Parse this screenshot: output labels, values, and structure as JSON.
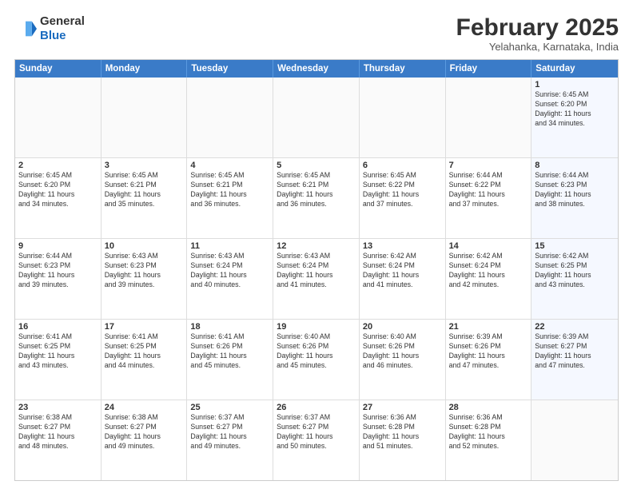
{
  "header": {
    "logo_general": "General",
    "logo_blue": "Blue",
    "month": "February 2025",
    "location": "Yelahanka, Karnataka, India"
  },
  "weekdays": [
    "Sunday",
    "Monday",
    "Tuesday",
    "Wednesday",
    "Thursday",
    "Friday",
    "Saturday"
  ],
  "rows": [
    [
      {
        "day": "",
        "info": ""
      },
      {
        "day": "",
        "info": ""
      },
      {
        "day": "",
        "info": ""
      },
      {
        "day": "",
        "info": ""
      },
      {
        "day": "",
        "info": ""
      },
      {
        "day": "",
        "info": ""
      },
      {
        "day": "1",
        "info": "Sunrise: 6:45 AM\nSunset: 6:20 PM\nDaylight: 11 hours\nand 34 minutes."
      }
    ],
    [
      {
        "day": "2",
        "info": "Sunrise: 6:45 AM\nSunset: 6:20 PM\nDaylight: 11 hours\nand 34 minutes."
      },
      {
        "day": "3",
        "info": "Sunrise: 6:45 AM\nSunset: 6:21 PM\nDaylight: 11 hours\nand 35 minutes."
      },
      {
        "day": "4",
        "info": "Sunrise: 6:45 AM\nSunset: 6:21 PM\nDaylight: 11 hours\nand 36 minutes."
      },
      {
        "day": "5",
        "info": "Sunrise: 6:45 AM\nSunset: 6:21 PM\nDaylight: 11 hours\nand 36 minutes."
      },
      {
        "day": "6",
        "info": "Sunrise: 6:45 AM\nSunset: 6:22 PM\nDaylight: 11 hours\nand 37 minutes."
      },
      {
        "day": "7",
        "info": "Sunrise: 6:44 AM\nSunset: 6:22 PM\nDaylight: 11 hours\nand 37 minutes."
      },
      {
        "day": "8",
        "info": "Sunrise: 6:44 AM\nSunset: 6:23 PM\nDaylight: 11 hours\nand 38 minutes."
      }
    ],
    [
      {
        "day": "9",
        "info": "Sunrise: 6:44 AM\nSunset: 6:23 PM\nDaylight: 11 hours\nand 39 minutes."
      },
      {
        "day": "10",
        "info": "Sunrise: 6:43 AM\nSunset: 6:23 PM\nDaylight: 11 hours\nand 39 minutes."
      },
      {
        "day": "11",
        "info": "Sunrise: 6:43 AM\nSunset: 6:24 PM\nDaylight: 11 hours\nand 40 minutes."
      },
      {
        "day": "12",
        "info": "Sunrise: 6:43 AM\nSunset: 6:24 PM\nDaylight: 11 hours\nand 41 minutes."
      },
      {
        "day": "13",
        "info": "Sunrise: 6:42 AM\nSunset: 6:24 PM\nDaylight: 11 hours\nand 41 minutes."
      },
      {
        "day": "14",
        "info": "Sunrise: 6:42 AM\nSunset: 6:24 PM\nDaylight: 11 hours\nand 42 minutes."
      },
      {
        "day": "15",
        "info": "Sunrise: 6:42 AM\nSunset: 6:25 PM\nDaylight: 11 hours\nand 43 minutes."
      }
    ],
    [
      {
        "day": "16",
        "info": "Sunrise: 6:41 AM\nSunset: 6:25 PM\nDaylight: 11 hours\nand 43 minutes."
      },
      {
        "day": "17",
        "info": "Sunrise: 6:41 AM\nSunset: 6:25 PM\nDaylight: 11 hours\nand 44 minutes."
      },
      {
        "day": "18",
        "info": "Sunrise: 6:41 AM\nSunset: 6:26 PM\nDaylight: 11 hours\nand 45 minutes."
      },
      {
        "day": "19",
        "info": "Sunrise: 6:40 AM\nSunset: 6:26 PM\nDaylight: 11 hours\nand 45 minutes."
      },
      {
        "day": "20",
        "info": "Sunrise: 6:40 AM\nSunset: 6:26 PM\nDaylight: 11 hours\nand 46 minutes."
      },
      {
        "day": "21",
        "info": "Sunrise: 6:39 AM\nSunset: 6:26 PM\nDaylight: 11 hours\nand 47 minutes."
      },
      {
        "day": "22",
        "info": "Sunrise: 6:39 AM\nSunset: 6:27 PM\nDaylight: 11 hours\nand 47 minutes."
      }
    ],
    [
      {
        "day": "23",
        "info": "Sunrise: 6:38 AM\nSunset: 6:27 PM\nDaylight: 11 hours\nand 48 minutes."
      },
      {
        "day": "24",
        "info": "Sunrise: 6:38 AM\nSunset: 6:27 PM\nDaylight: 11 hours\nand 49 minutes."
      },
      {
        "day": "25",
        "info": "Sunrise: 6:37 AM\nSunset: 6:27 PM\nDaylight: 11 hours\nand 49 minutes."
      },
      {
        "day": "26",
        "info": "Sunrise: 6:37 AM\nSunset: 6:27 PM\nDaylight: 11 hours\nand 50 minutes."
      },
      {
        "day": "27",
        "info": "Sunrise: 6:36 AM\nSunset: 6:28 PM\nDaylight: 11 hours\nand 51 minutes."
      },
      {
        "day": "28",
        "info": "Sunrise: 6:36 AM\nSunset: 6:28 PM\nDaylight: 11 hours\nand 52 minutes."
      },
      {
        "day": "",
        "info": ""
      }
    ]
  ]
}
